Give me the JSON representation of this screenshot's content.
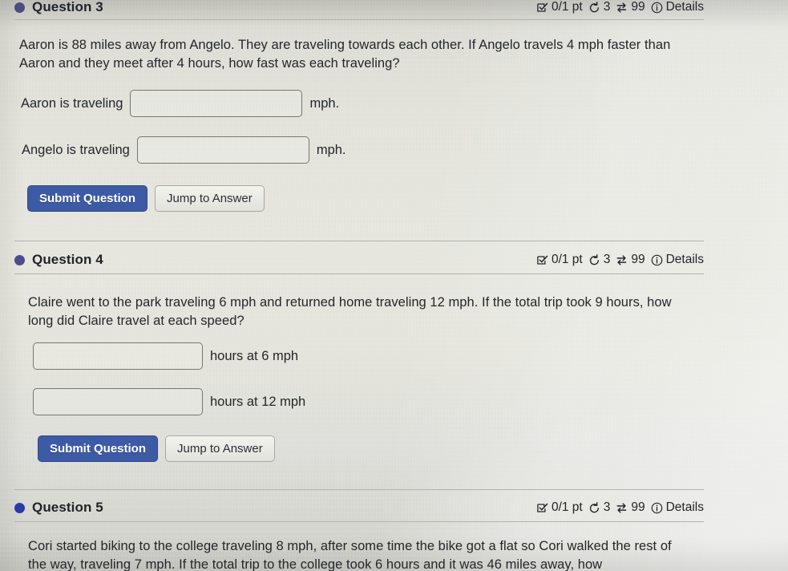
{
  "page": {
    "background_color": "#e3e3dc",
    "text_color": "#23262c"
  },
  "icons": {
    "checkbox_check": "checkbox-check-icon",
    "retry": "retry-arrow-icon",
    "attempts": "exchange-arrows-icon",
    "info": "info-circle-icon"
  },
  "questions": [
    {
      "id": "q3",
      "title": "Question 3",
      "bullet_color": "#4a4e7e",
      "meta": {
        "points": "0/1 pt",
        "retries": "3",
        "attempts": "99",
        "details_label": "Details"
      },
      "prompt": "Aaron is 88 miles away from Angelo. They are traveling towards each other. If Angelo travels 4 mph faster than Aaron and they meet after 4 hours, how fast was each traveling?",
      "answers": [
        {
          "prefix": "Aaron is traveling",
          "value": "",
          "placeholder": "",
          "suffix": "mph."
        },
        {
          "prefix": "Angelo is traveling",
          "value": "",
          "placeholder": "",
          "suffix": "mph."
        }
      ],
      "buttons": {
        "submit": "Submit Question",
        "jump": "Jump to Answer"
      }
    },
    {
      "id": "q4",
      "title": "Question 4",
      "bullet_color": "#4a4e8c",
      "meta": {
        "points": "0/1 pt",
        "retries": "3",
        "attempts": "99",
        "details_label": "Details"
      },
      "prompt": "Claire went to the park traveling 6 mph and returned home traveling 12 mph. If the total trip took 9 hours, how long did Claire travel at each speed?",
      "answers": [
        {
          "prefix": "",
          "value": "",
          "placeholder": "",
          "suffix": "hours at 6 mph"
        },
        {
          "prefix": "",
          "value": "",
          "placeholder": "",
          "suffix": "hours at 12 mph"
        }
      ],
      "buttons": {
        "submit": "Submit Question",
        "jump": "Jump to Answer"
      }
    },
    {
      "id": "q5",
      "title": "Question 5",
      "bullet_color": "#2a3aa8",
      "meta": {
        "points": "0/1 pt",
        "retries": "3",
        "attempts": "99",
        "details_label": "Details"
      },
      "prompt": "Cori started biking to the college traveling 8 mph, after some time the bike got a flat so Cori walked the rest of the way, traveling 7 mph. If the total trip to the college took 6 hours and it was 46 miles away, how"
    }
  ]
}
